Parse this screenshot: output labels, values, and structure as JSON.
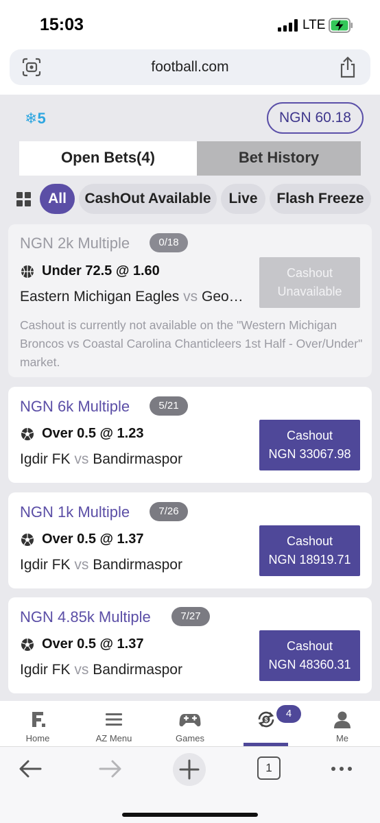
{
  "status_bar": {
    "time": "15:03",
    "network": "LTE"
  },
  "url_bar": {
    "url": "football.com"
  },
  "header": {
    "freeze_count": "5",
    "balance": "NGN 60.18"
  },
  "tabs": {
    "open_bets": "Open Bets(4)",
    "bet_history": "Bet History"
  },
  "filters": [
    "All",
    "CashOut Available",
    "Live",
    "Flash Freeze"
  ],
  "bets": [
    {
      "stake": "NGN 2k  Multiple",
      "progress": "0/18",
      "selection": "Under 72.5 @ 1.60",
      "home": "Eastern Michigan Eagles",
      "vs": "vs",
      "away": "Geo…",
      "cashout_line1": "Cashout",
      "cashout_line2": "Unavailable",
      "notice": "Cashout is currently not available on the \"Western Michigan Broncos vs Coastal Carolina Chanticleers 1st Half - Over/Under\" market."
    },
    {
      "stake": "NGN 6k  Multiple",
      "progress": "5/21",
      "selection": "Over 0.5 @ 1.23",
      "home": "Igdir FK",
      "vs": "vs",
      "away": "Bandirmaspor",
      "cashout_line1": "Cashout",
      "cashout_line2": "NGN 33067.98"
    },
    {
      "stake": "NGN 1k  Multiple",
      "progress": "7/26",
      "selection": "Over 0.5 @ 1.37",
      "home": "Igdir FK",
      "vs": "vs",
      "away": "Bandirmaspor",
      "cashout_line1": "Cashout",
      "cashout_line2": "NGN 18919.71"
    },
    {
      "stake": "NGN 4.85k  Multiple",
      "progress": "7/27",
      "selection": "Over 0.5 @ 1.37",
      "home": "Igdir FK",
      "vs": "vs",
      "away": "Bandirmaspor",
      "cashout_line1": "Cashout",
      "cashout_line2": "NGN 48360.31"
    }
  ],
  "bottom_nav": {
    "items": [
      {
        "label": "Home",
        "icon": "football-logo-icon"
      },
      {
        "label": "AZ Menu",
        "icon": "menu-icon"
      },
      {
        "label": "Games",
        "icon": "gamepad-icon"
      },
      {
        "label": "",
        "icon": "cashout-icon"
      },
      {
        "label": "Me",
        "icon": "user-icon"
      }
    ],
    "badge": "4"
  },
  "browser_bar": {
    "tab_count": "1"
  },
  "colors": {
    "accent": "#4f4899",
    "freeze": "#2ea6e0",
    "muted": "#9a9aa2"
  }
}
